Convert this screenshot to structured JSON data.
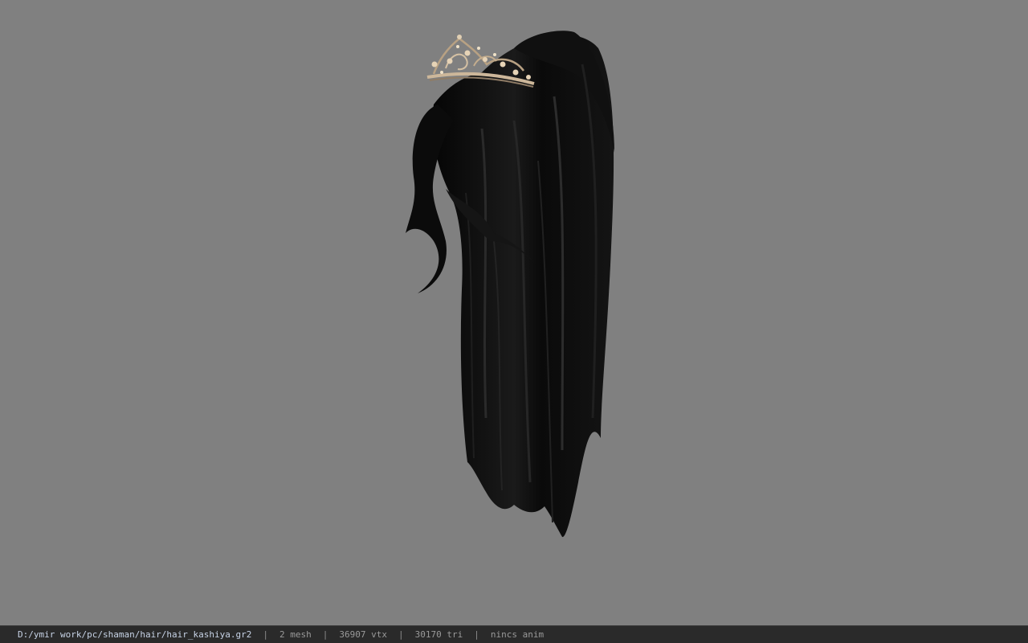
{
  "viewport": {
    "model_name": "hair_kashiya",
    "background_color": "#808080",
    "hair_color": "#0c0c0c",
    "tiara_color": "#d9c4a6"
  },
  "status": {
    "file_path": "D:/ymir work/pc/shaman/hair/hair_kashiya.gr2",
    "separator": "|",
    "mesh": "2 mesh",
    "vtx": "36907 vtx",
    "tri": "30170 tri",
    "anim": "nincs anim"
  }
}
